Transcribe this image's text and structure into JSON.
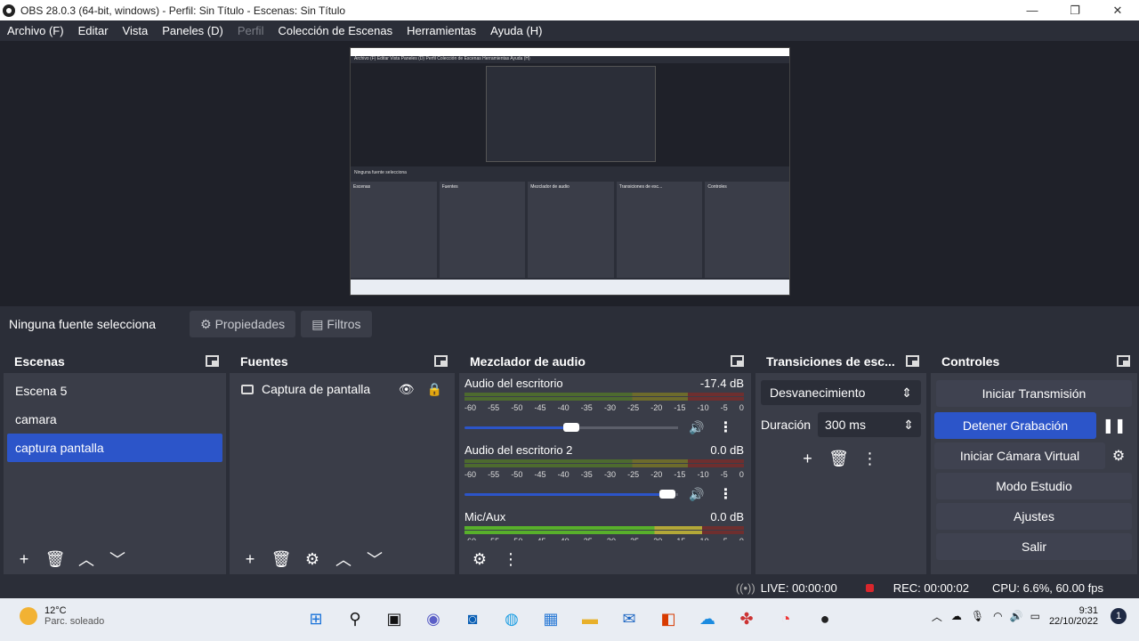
{
  "window": {
    "title": "OBS 28.0.3 (64-bit, windows) - Perfil: Sin Título - Escenas: Sin Título"
  },
  "menu": [
    "Archivo (F)",
    "Editar",
    "Vista",
    "Paneles (D)",
    "Perfil",
    "Colección de Escenas",
    "Herramientas",
    "Ayuda (H)"
  ],
  "source_toolbar": {
    "label": "Ninguna fuente selecciona",
    "properties": "Propiedades",
    "filters": "Filtros"
  },
  "scenes": {
    "title": "Escenas",
    "items": [
      "Escena 5",
      "camara",
      "captura pantalla"
    ],
    "selected": 2
  },
  "sources": {
    "title": "Fuentes",
    "items": [
      "Captura de pantalla"
    ]
  },
  "mixer": {
    "title": "Mezclador de audio",
    "scale": [
      "-60",
      "-55",
      "-50",
      "-45",
      "-40",
      "-35",
      "-30",
      "-25",
      "-20",
      "-15",
      "-10",
      "-5",
      "0"
    ],
    "channels": [
      {
        "name": "Audio del escritorio",
        "db": "-17.4 dB",
        "level": 0.5
      },
      {
        "name": "Audio del escritorio 2",
        "db": "0.0 dB",
        "level": 0.95
      },
      {
        "name": "Mic/Aux",
        "db": "0.0 dB",
        "level": 0.95
      }
    ]
  },
  "transitions": {
    "title": "Transiciones de esc...",
    "selected": "Desvanecimiento",
    "duration_label": "Duración",
    "duration": "300 ms"
  },
  "controls": {
    "title": "Controles",
    "start_stream": "Iniciar Transmisión",
    "stop_record": "Detener Grabación",
    "virtual_cam": "Iniciar Cámara Virtual",
    "studio": "Modo Estudio",
    "settings": "Ajustes",
    "exit": "Salir"
  },
  "status": {
    "live": "LIVE: 00:00:00",
    "rec": "REC: 00:00:02",
    "cpu": "CPU: 6.6%, 60.00 fps"
  },
  "taskbar": {
    "temp": "12°C",
    "weather": "Parc. soleado",
    "time": "9:31",
    "date": "22/10/2022",
    "notif": "1"
  },
  "preview_mini": {
    "menu": "Archivo (F)  Editar  Vista  Paneles (D)  Perfil  Colección de Escenas  Herramientas  Ayuda (H)",
    "row": "Ninguna fuente selecciona",
    "docks": [
      "Escenas",
      "Fuentes",
      "Mezclador de audio",
      "Transiciones de esc...",
      "Controles"
    ]
  }
}
